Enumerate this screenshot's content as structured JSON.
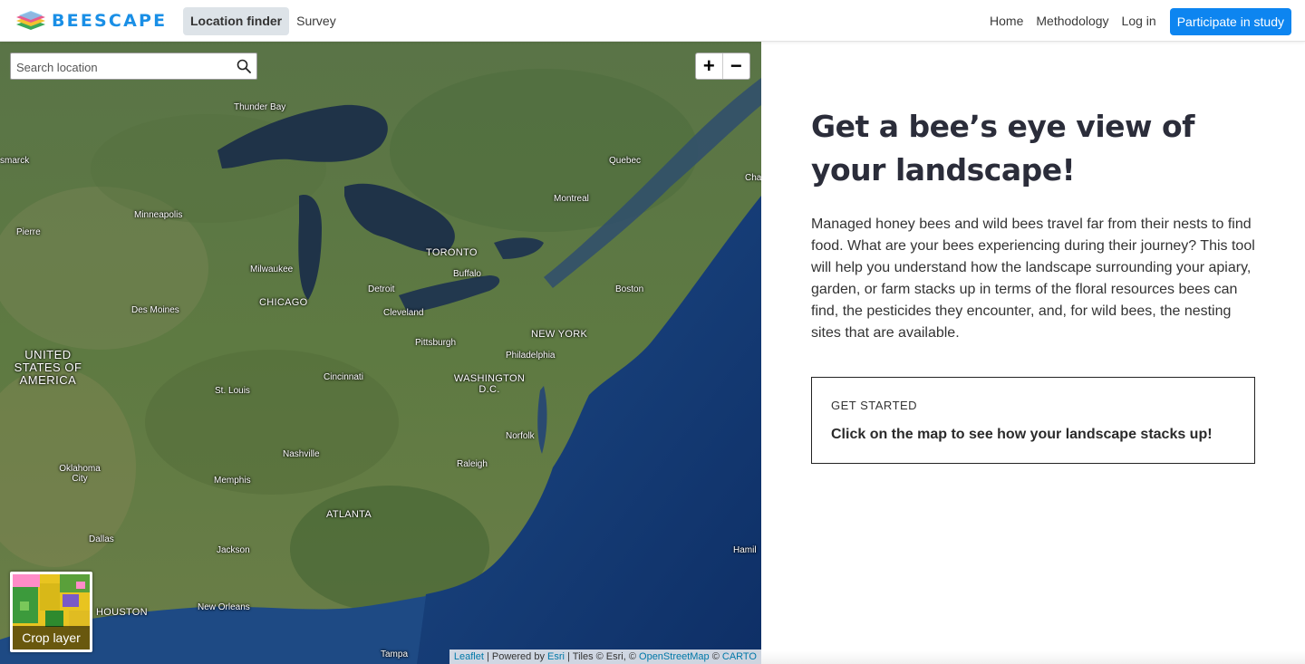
{
  "app": {
    "brand": "BEESCAPE",
    "colors": {
      "accent": "#0d85f0",
      "brand": "#1a8fe6",
      "text_dark": "#2b2d3a"
    }
  },
  "nav": {
    "left": [
      {
        "label": "Location finder",
        "active": true
      },
      {
        "label": "Survey",
        "active": false
      }
    ],
    "right": [
      {
        "label": "Home"
      },
      {
        "label": "Methodology"
      },
      {
        "label": "Log in"
      }
    ],
    "cta_label": "Participate in study"
  },
  "map": {
    "search": {
      "placeholder": "Search location",
      "icon": "search-icon"
    },
    "zoom": {
      "in_label": "+",
      "out_label": "−"
    },
    "crop_layer_label": "Crop layer",
    "labels": {
      "thunder_bay": "Thunder Bay",
      "bismarck": "smarck",
      "quebec": "Quebec",
      "montreal": "Montreal",
      "minneapolis": "Minneapolis",
      "pierre": "Pierre",
      "toronto": "TORONTO",
      "buffalo": "Buffalo",
      "milwaukee": "Milwaukee",
      "detroit": "Detroit",
      "boston": "Boston",
      "chicago": "CHICAGO",
      "cleveland": "Cleveland",
      "des_moines": "Des Moines",
      "new_york": "NEW YORK",
      "pittsburgh": "Pittsburgh",
      "philadelphia": "Philadelphia",
      "usa": "UNITED STATES OF AMERICA",
      "washington": "WASHINGTON D.C.",
      "cincinnati": "Cincinnati",
      "st_louis": "St. Louis",
      "norfolk": "Norfolk",
      "nashville": "Nashville",
      "raleigh": "Raleigh",
      "oklahoma_city": "Oklahoma City",
      "memphis": "Memphis",
      "atlanta": "ATLANTA",
      "dallas": "Dallas",
      "jackson": "Jackson",
      "houston": "HOUSTON",
      "new_orleans": "New Orleans",
      "tampa": "Tampa",
      "hamilton": "Hamil",
      "charlottetown": "Cha"
    },
    "attribution": {
      "leaflet": "Leaflet",
      "sep1": " | Powered by ",
      "esri": "Esri",
      "sep2": " | Tiles © Esri, © ",
      "osm": "OpenStreetMap",
      "sep3": " © ",
      "carto": "CARTO"
    }
  },
  "panel": {
    "headline": "Get a bee’s eye view of your landscape!",
    "intro": "Managed honey bees and wild bees travel far from their nests to find food. What are your bees experiencing during their journey? This tool will help you understand how the landscape surrounding your apiary, garden, or farm stacks up in terms of the floral resources bees can find, the pesticides they encounter, and, for wild bees, the nesting sites that are available.",
    "get_started": {
      "eyebrow": "GET STARTED",
      "text": "Click on the map to see how your landscape stacks up!"
    }
  }
}
